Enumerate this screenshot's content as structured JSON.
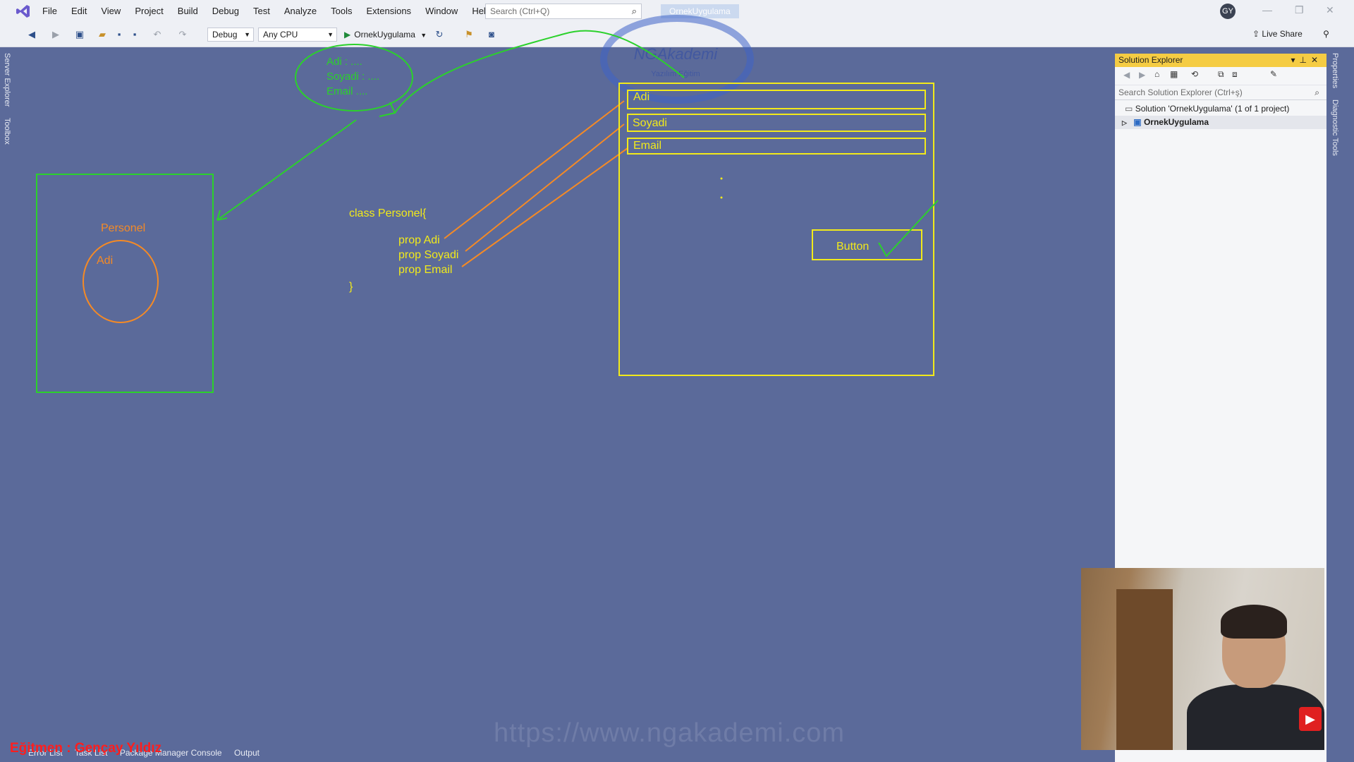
{
  "menu": {
    "items": [
      "File",
      "Edit",
      "View",
      "Project",
      "Build",
      "Debug",
      "Test",
      "Analyze",
      "Tools",
      "Extensions",
      "Window",
      "Help"
    ],
    "search_placeholder": "Search (Ctrl+Q)",
    "solution_pill": "OrnekUygulama",
    "avatar_initials": "GY"
  },
  "toolbar": {
    "config": "Debug",
    "platform": "Any CPU",
    "run_target": "OrnekUygulama",
    "live_share": "Live Share"
  },
  "left_tabs": [
    "Server Explorer",
    "Toolbox"
  ],
  "right_tabs": [
    "Properties",
    "Diagnostic Tools"
  ],
  "solution_explorer": {
    "title": "Solution Explorer",
    "search_placeholder": "Search Solution Explorer (Ctrl+ş)",
    "solution_label": "Solution 'OrnekUygulama' (1 of 1 project)",
    "project_label": "OrnekUygulama"
  },
  "drawing": {
    "note_lines": [
      "Adi  : ....",
      "Soyadi : ....",
      "Email ...."
    ],
    "class_box_title": "Personel",
    "class_box_circle": "Adi",
    "code_lines": [
      "class Personel{",
      "prop Adi",
      "prop Soyadi",
      "prop Email",
      "}"
    ],
    "form_fields": [
      "Adi",
      "Soyadi",
      "Email"
    ],
    "form_button": "Button",
    "logo_text": "NGAkademi",
    "logo_sub": "Yazılım Eğitim"
  },
  "bottom": {
    "tabs": [
      "Error List",
      "Task List",
      "Package Manager Console",
      "Output"
    ],
    "instructor": "Eğitmen : Gençay Yıldız",
    "url": "https://www.ngakademi.com"
  },
  "colors": {
    "canvas": "#5b6a9a",
    "green": "#2bd12b",
    "yellow": "#f2ea1a",
    "orange": "#f58a25",
    "panel_title": "#f5cc43"
  }
}
